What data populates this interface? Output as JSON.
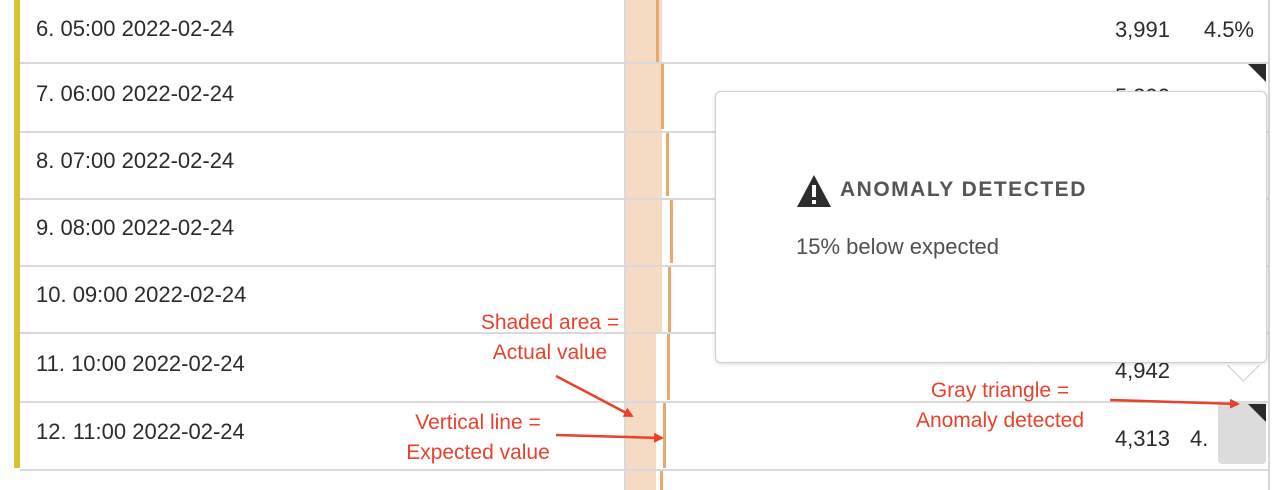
{
  "rows": [
    {
      "label": "6.  05:00 2022-02-24",
      "count": "3,991",
      "pct": "4.5%"
    },
    {
      "label": "7.  06:00 2022-02-24",
      "count": "5,390",
      "pct": ""
    },
    {
      "label": "8.  07:00 2022-02-24",
      "count": "",
      "pct": ""
    },
    {
      "label": "9.  08:00 2022-02-24",
      "count": "",
      "pct": ""
    },
    {
      "label": "10.  09:00 2022-02-24",
      "count": "",
      "pct": ""
    },
    {
      "label": "11.  10:00 2022-02-24",
      "count": "4,942",
      "pct": ""
    },
    {
      "label": "12.  11:00 2022-02-24",
      "count": "4,313",
      "pct": "4."
    }
  ],
  "popover": {
    "title": "ANOMALY DETECTED",
    "message": "15% below expected",
    "icon": "warning-triangle-icon"
  },
  "annotations": {
    "shaded_line1": "Shaded area =",
    "shaded_line2": "Actual value",
    "vertical_line1": "Vertical line =",
    "vertical_line2": "Expected value",
    "gray_line1": "Gray triangle =",
    "gray_line2": "Anomaly detected"
  },
  "colors": {
    "accent_bar": "#d8c335",
    "actual_fill": "#f5dbc4",
    "expected_line": "#e8a96a",
    "annotation": "#e8412c"
  }
}
